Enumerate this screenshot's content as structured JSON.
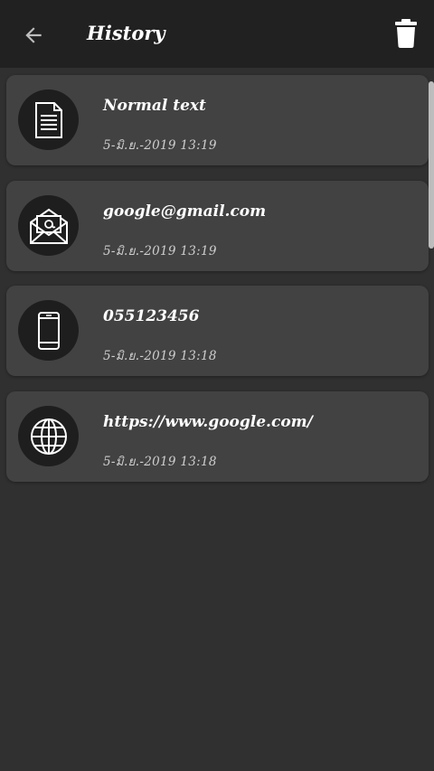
{
  "header": {
    "title": "History",
    "back_icon": "arrow-back-icon",
    "delete_icon": "trash-icon"
  },
  "items": [
    {
      "title": "Normal text",
      "date": "5-มิ.ย.-2019 13:19",
      "icon": "document-icon"
    },
    {
      "title": "google@gmail.com",
      "date": "5-มิ.ย.-2019 13:19",
      "icon": "email-icon"
    },
    {
      "title": "055123456",
      "date": "5-มิ.ย.-2019 13:18",
      "icon": "phone-icon"
    },
    {
      "title": "https://www.google.com/",
      "date": "5-มิ.ย.-2019 13:18",
      "icon": "globe-icon"
    }
  ],
  "colors": {
    "background": "#303030",
    "appbar": "#212121",
    "card": "#424242",
    "icon_circle": "#1e1e1e",
    "text": "#ffffff"
  }
}
